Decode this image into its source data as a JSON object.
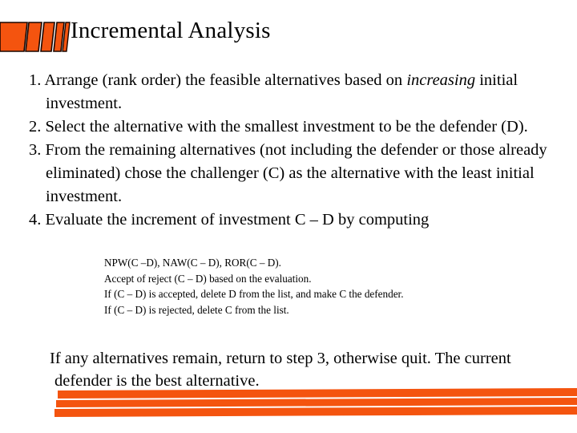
{
  "slide": {
    "title": "Incremental Analysis",
    "accent_color": "#F4540F",
    "text_color": "#000000",
    "background_color": "#FFFFFF"
  },
  "decor": {
    "top_left_icon": "slanted-bars-icon",
    "bottom_rule": "slanted-triple-bar-rule"
  },
  "list": {
    "items": [
      {
        "number": "1.",
        "parts": [
          {
            "text": "Arrange (rank order) the feasible alternatives based on ",
            "style": "normal"
          },
          {
            "text": "increasing",
            "style": "italic"
          },
          {
            "text": " initial investment.",
            "style": "normal"
          }
        ]
      },
      {
        "number": "2.",
        "parts": [
          {
            "text": "Select the alternative with the smallest investment to be the defender (D).",
            "style": "normal"
          }
        ]
      },
      {
        "number": "3.",
        "parts": [
          {
            "text": "From the remaining alternatives (not including the defender or those already eliminated) chose the challenger (C) as the alternative with the least initial investment.",
            "style": "normal"
          }
        ]
      },
      {
        "number": "4.",
        "parts": [
          {
            "text": "Evaluate the increment of investment C – D by computing",
            "style": "normal"
          }
        ]
      }
    ]
  },
  "sub_lines": [
    "NPW(C –D), NAW(C – D), ROR(C – D).",
    "Accept of reject (C – D) based on the evaluation.",
    "If (C – D) is accepted, delete D from the list, and make C the defender.",
    "If (C – D) is rejected, delete C from the list."
  ],
  "closing_paragraph": "If any alternatives remain, return to step 3, otherwise quit. The current defender is the best alternative."
}
